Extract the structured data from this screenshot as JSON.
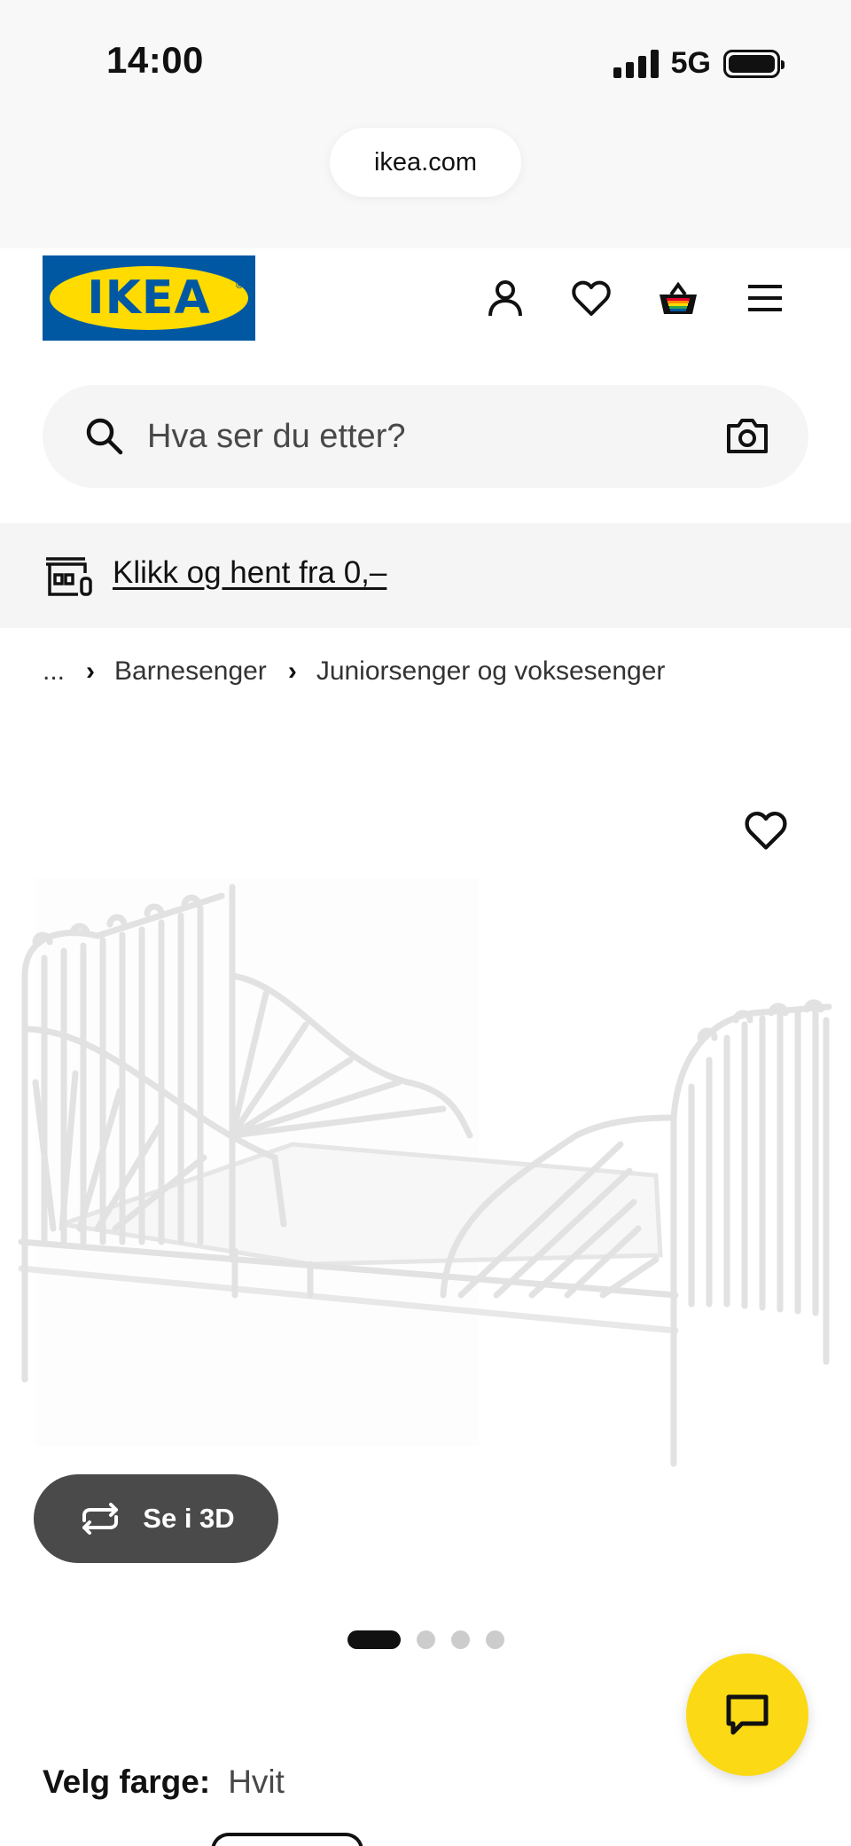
{
  "status_bar": {
    "time": "14:00",
    "network": "5G"
  },
  "browser": {
    "url": "ikea.com"
  },
  "header": {
    "logo_text": "IKEA",
    "icons": {
      "account": "person-icon",
      "favorites": "heart-icon",
      "cart": "basket-icon",
      "menu": "hamburger-menu-icon"
    },
    "brand_colors": {
      "blue": "#0058a3",
      "yellow": "#ffdb00"
    }
  },
  "search": {
    "placeholder": "Hva ser du etter?",
    "value": ""
  },
  "promo": {
    "link_text": "Klikk og hent fra 0,–"
  },
  "breadcrumb": {
    "ellipsis": "...",
    "items": [
      "Barnesenger",
      "Juniorsenger og voksesenger"
    ]
  },
  "gallery": {
    "view_3d_label": "Se i 3D",
    "total_images": 4,
    "active_index": 0
  },
  "product": {
    "color_label": "Velg farge:",
    "color_value": "Hvit"
  },
  "chat": {
    "accent": "#fbd914"
  }
}
